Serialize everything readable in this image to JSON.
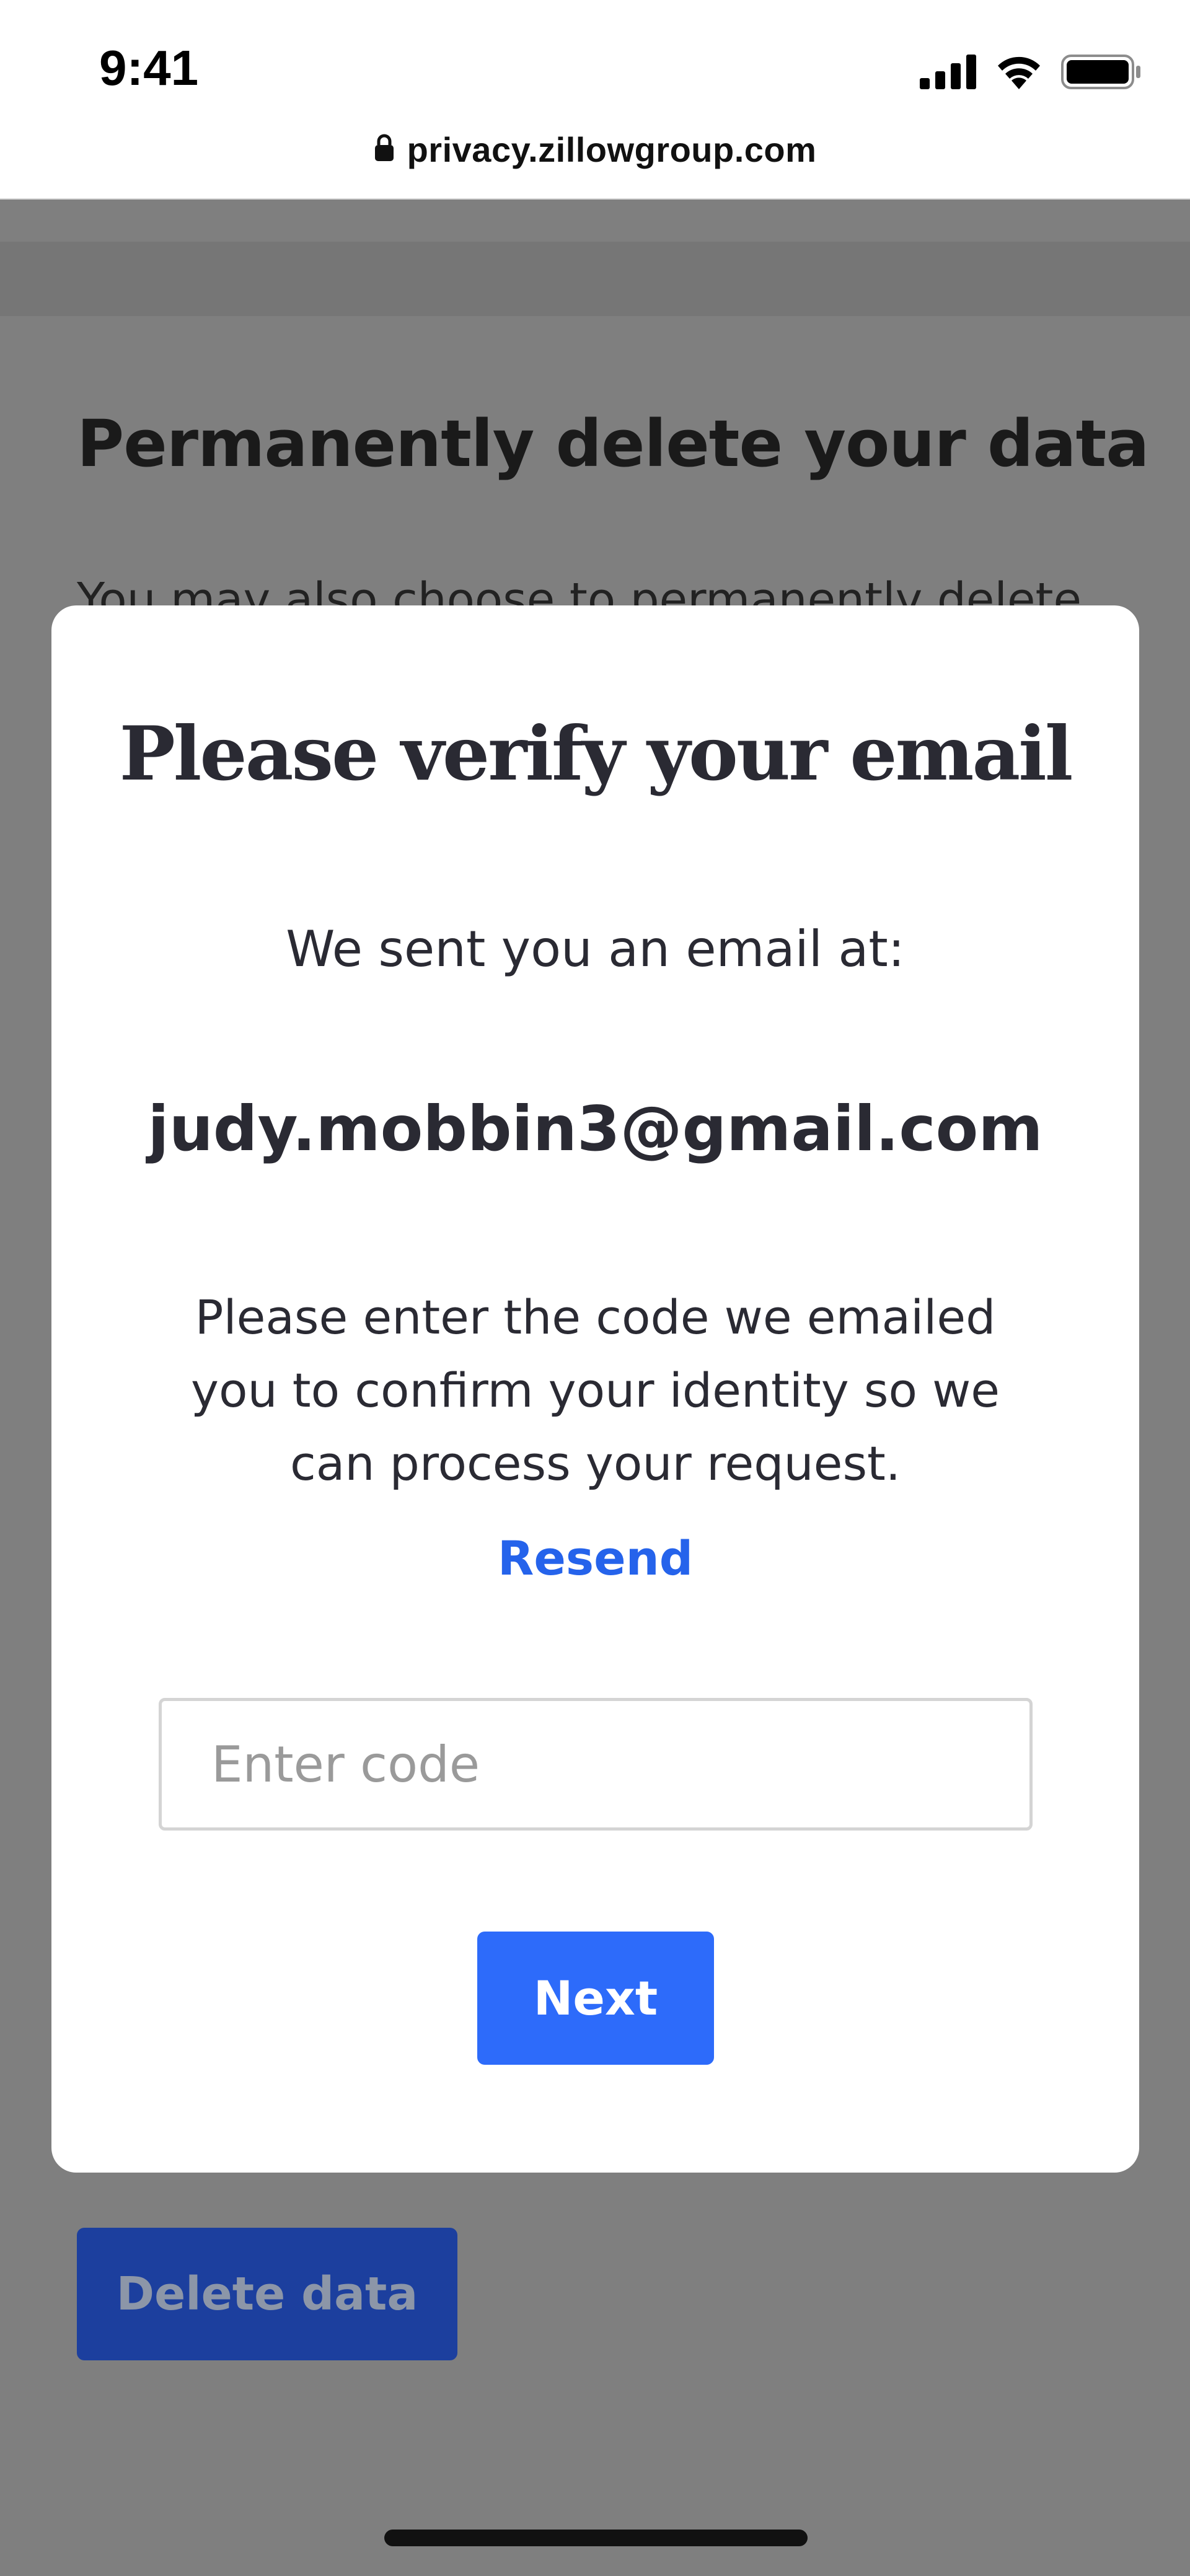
{
  "status_bar": {
    "time": "9:41",
    "icons": [
      "cellular-signal-icon",
      "wifi-icon",
      "battery-icon"
    ]
  },
  "browser": {
    "url": "privacy.zillowgroup.com",
    "lock_icon": "lock-icon"
  },
  "background_page": {
    "heading": "Permanently delete your data",
    "paragraph_visible": "You may also choose to permanently delete",
    "delete_button_label": "Delete data"
  },
  "modal": {
    "title": "Please verify your email",
    "sent_label": "We sent you an email at:",
    "email": "judy.mobbin3@gmail.com",
    "instructions": "Please enter the code we emailed you to confirm your identity so we can process your request.",
    "resend_label": "Resend",
    "code_input": {
      "placeholder": "Enter code",
      "value": ""
    },
    "next_label": "Next"
  },
  "colors": {
    "overlay": "#7f7f7f",
    "primary_button": "#2d6bfa",
    "link": "#2563eb",
    "text": "#2a2a33",
    "background_button": "#1c3f9e"
  }
}
